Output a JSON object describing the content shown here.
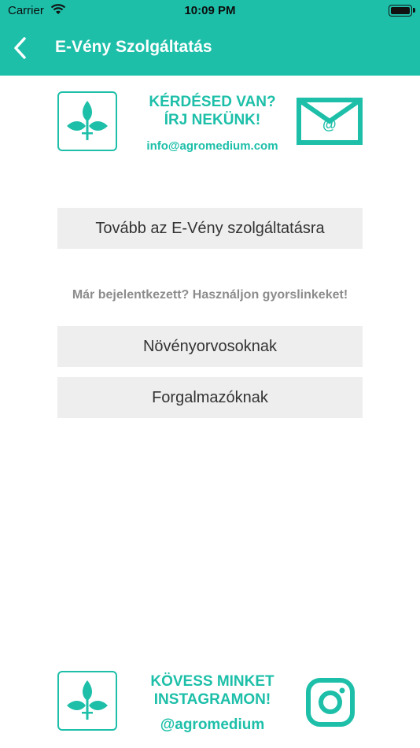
{
  "status_bar": {
    "carrier": "Carrier",
    "time": "10:09 PM"
  },
  "nav": {
    "title": "E-Vény Szolgáltatás",
    "back_icon": "chevron-left-icon"
  },
  "contact": {
    "line1": "KÉRDÉSED VAN?",
    "line2": "ÍRJ NEKÜNK!",
    "email": "info@agromedium.com",
    "icon": "mail-icon"
  },
  "main": {
    "continue_button": "Tovább az E-Vény szolgáltatásra",
    "quicklinks_hint": "Már bejelentkezett? Használjon gyorslinkeket!",
    "buttons": [
      "Növényorvosoknak",
      "Forgalmazóknak"
    ]
  },
  "instagram": {
    "line1": "KÖVESS MINKET",
    "line2": "INSTAGRAMON!",
    "handle": "@agromedium",
    "icon": "instagram-icon"
  },
  "colors": {
    "accent": "#1dbfa9",
    "button_bg": "#eeeeee",
    "hint": "#8c8c8c"
  }
}
